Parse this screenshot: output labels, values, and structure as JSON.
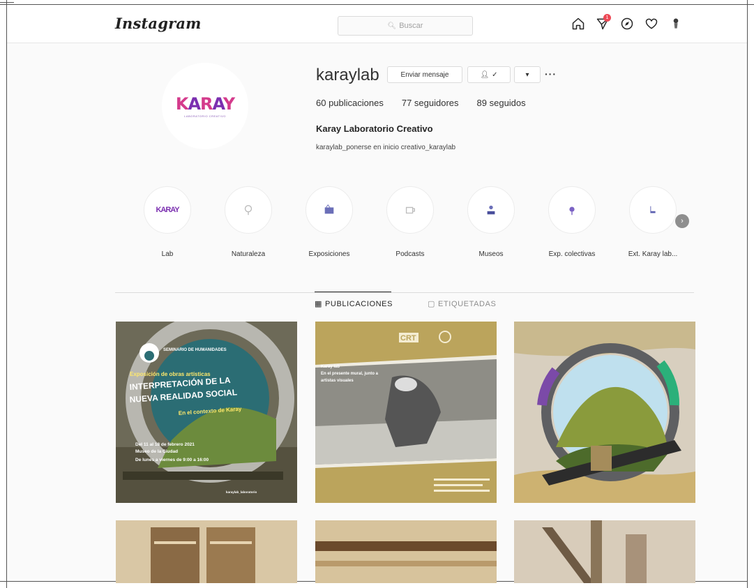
{
  "app": {
    "logo": "Instagram"
  },
  "search": {
    "placeholder": "Buscar"
  },
  "nav": {
    "notification_count": "1"
  },
  "profile": {
    "username": "karaylab",
    "message_button": "Enviar mensaje",
    "follow_button": "✓",
    "stats": {
      "posts": "60 publicaciones",
      "followers": "77 seguidores",
      "following": "89 seguidos"
    },
    "full_name": "Karay Laboratorio Creativo",
    "bio": "karaylab_ponerse en inicio creativo_karaylab",
    "avatar_text_a": "K",
    "avatar_text_b": "A",
    "avatar_text_c": "R",
    "avatar_text_d": "A",
    "avatar_text_e": "Y",
    "avatar_caption": "LABORATORIO CREATIVO"
  },
  "highlights": [
    {
      "label": "Lab"
    },
    {
      "label": "Naturaleza"
    },
    {
      "label": "Exposiciones"
    },
    {
      "label": "Podcasts"
    },
    {
      "label": "Museos"
    },
    {
      "label": "Exp. colectivas"
    },
    {
      "label": "Ext. Karay lab..."
    }
  ],
  "tabs": {
    "posts": "PUBLICACIONES",
    "tagged": "ETIQUETADAS"
  },
  "posts": [
    {
      "header": "SEMINARIO DE HUMANIDADES",
      "kicker": "Exposición de obras artísticas",
      "title_1": "INTERPRETACIÓN DE LA",
      "title_2": "NUEVA REALIDAD SOCIAL",
      "subtitle": "En el contexto de Karay",
      "date": "Del 11 al 18 de febrero 2021",
      "place": "Museo de la Ciudad",
      "hours": "De lunes a viernes de 9:00 a 16:00",
      "footer": "karaylab_laboratorio"
    },
    {
      "header": "CRT",
      "caption_1": "Karay lab",
      "caption_2": "En el presente mural, junto a",
      "caption_3": "artistas visuales"
    },
    {
      "caption": ""
    },
    {
      "caption": ""
    },
    {
      "caption": ""
    },
    {
      "caption": ""
    }
  ]
}
